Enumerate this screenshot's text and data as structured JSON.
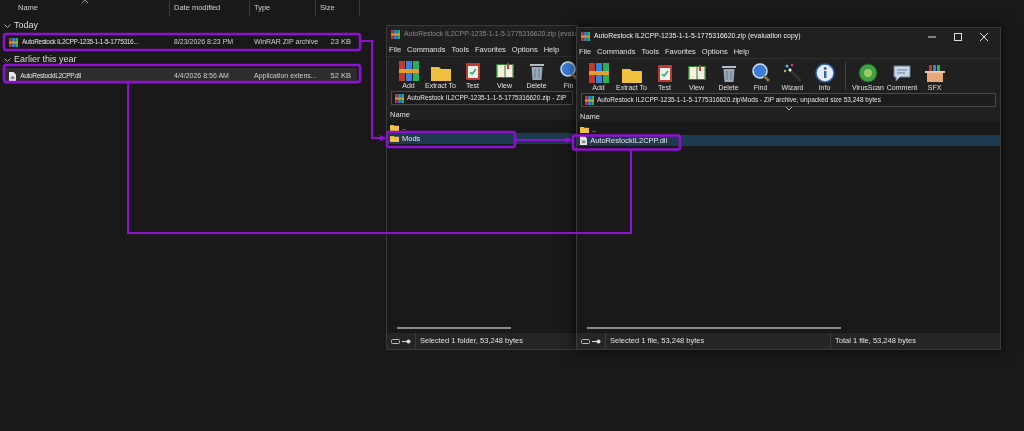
{
  "explorer": {
    "columns": [
      "Name",
      "Date modified",
      "Type",
      "Size"
    ],
    "groups": [
      {
        "label": "Today",
        "expanded": true,
        "rows": [
          {
            "name": "AutoRestock IL2CPP-1235-1-1-5-1775316...",
            "date": "8/23/2026 8:23 PM",
            "type": "WinRAR ZIP archive",
            "size": "23 KB",
            "kind": "archive",
            "selected": false
          }
        ]
      },
      {
        "label": "Earlier this year",
        "expanded": true,
        "rows": [
          {
            "name": "AutoRestockIL2CPP.dll",
            "date": "4/4/2026 8:56 AM",
            "type": "Application extens...",
            "size": "52 KB",
            "kind": "file",
            "selected": true
          }
        ]
      }
    ]
  },
  "windows": [
    {
      "title": "AutoRestock IL2CPP-1235-1-1-5-1775316620.zip (evalu",
      "active": false,
      "menu": [
        "File",
        "Commands",
        "Tools",
        "Favorites",
        "Options",
        "Help"
      ],
      "toolbar": [
        "Add",
        "Extract To",
        "Test",
        "View",
        "Delete",
        "Fin"
      ],
      "address": "AutoRestock IL2CPP-1235-1-1-5-1775316620.zip - ZIP",
      "column": "Name",
      "rows": [
        {
          "name": "..",
          "kind": "folder",
          "selected": false
        },
        {
          "name": "Mods",
          "kind": "folder",
          "selected": true
        }
      ],
      "status": [
        "Selected 1 folder, 53,248 bytes"
      ]
    },
    {
      "title": "AutoRestock IL2CPP-1235-1-1-5-1775316620.zip (evaluation copy)",
      "active": true,
      "menu": [
        "File",
        "Commands",
        "Tools",
        "Favorites",
        "Options",
        "Help"
      ],
      "toolbar": [
        "Add",
        "Extract To",
        "Test",
        "View",
        "Delete",
        "Find",
        "Wizard",
        "Info",
        "VirusScan",
        "Comment",
        "SFX"
      ],
      "address": "AutoRestock IL2CPP-1235-1-1-5-1775316620.zip\\Mods - ZIP archive, unpacked size 53,248 bytes",
      "column": "Name",
      "rows": [
        {
          "name": "..",
          "kind": "folder",
          "selected": false
        },
        {
          "name": "AutoRestockIL2CPP.dll",
          "kind": "file",
          "selected": true
        }
      ],
      "status": [
        "Selected 1 file, 53,248 bytes",
        "Total 1 file, 53,248 bytes"
      ]
    }
  ]
}
